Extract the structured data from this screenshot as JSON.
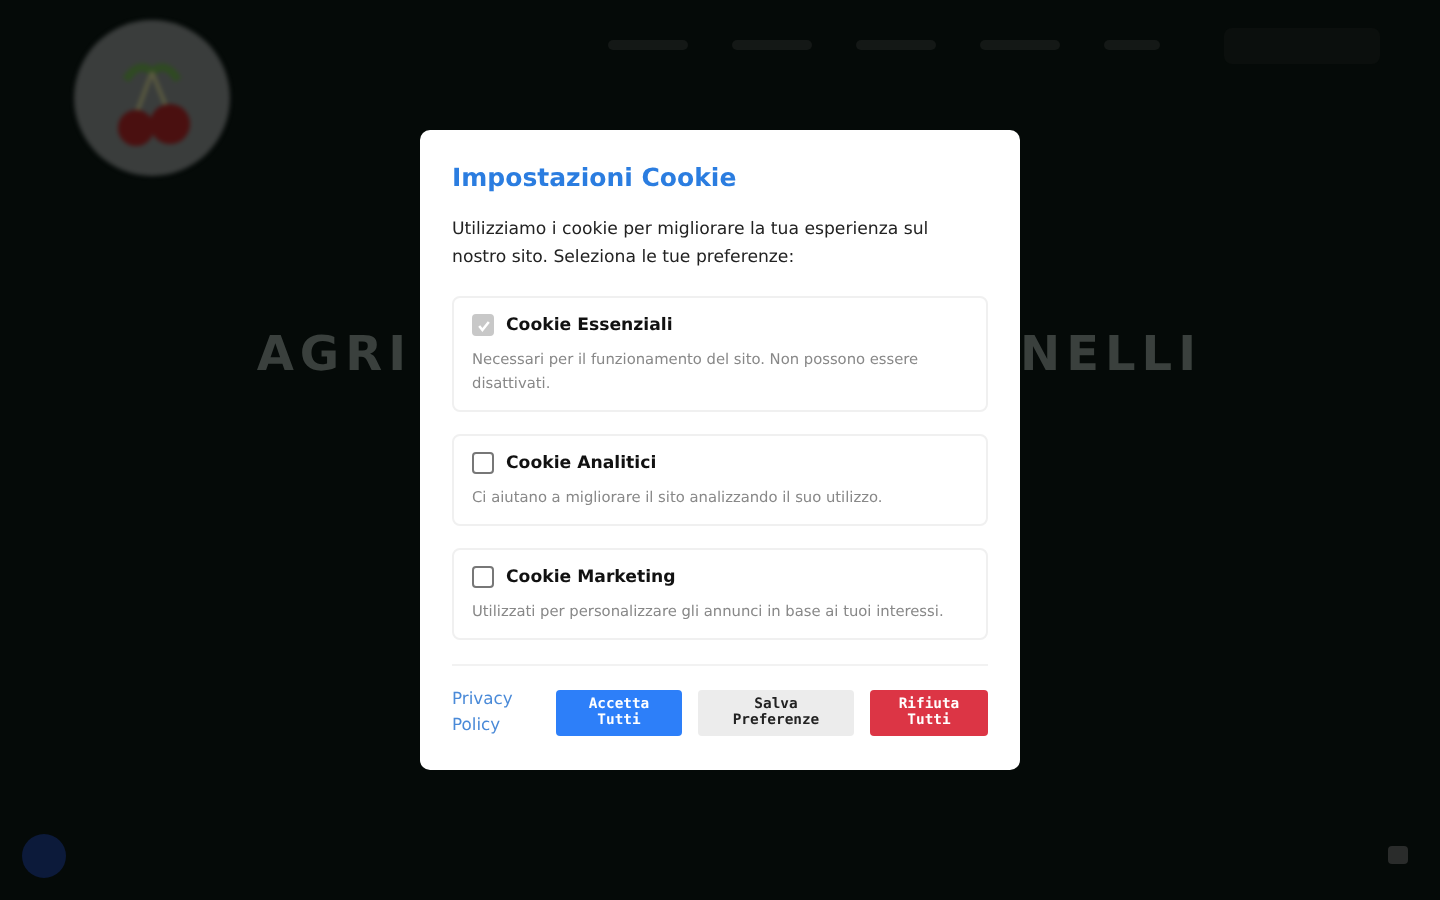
{
  "hero": {
    "title_left": "AGRI",
    "title_right": "NELLI"
  },
  "cookie_dialog": {
    "title": "Impostazioni Cookie",
    "intro": "Utilizziamo i cookie per migliorare la tua esperienza sul nostro sito. Seleziona le tue preferenze:",
    "options": [
      {
        "label": "Cookie Essenziali",
        "description": "Necessari per il funzionamento del sito. Non possono essere disattivati.",
        "checked": true,
        "disabled": true
      },
      {
        "label": "Cookie Analitici",
        "description": "Ci aiutano a migliorare il sito analizzando il suo utilizzo.",
        "checked": false,
        "disabled": false
      },
      {
        "label": "Cookie Marketing",
        "description": "Utilizzati per personalizzare gli annunci in base ai tuoi interessi.",
        "checked": false,
        "disabled": false
      }
    ],
    "privacy_link": "Privacy Policy",
    "buttons": [
      {
        "label": "Accetta Tutti",
        "kind": "primary"
      },
      {
        "label": "Salva Preferenze",
        "kind": "secondary"
      },
      {
        "label": "Rifiuta Tutti",
        "kind": "danger"
      }
    ]
  }
}
